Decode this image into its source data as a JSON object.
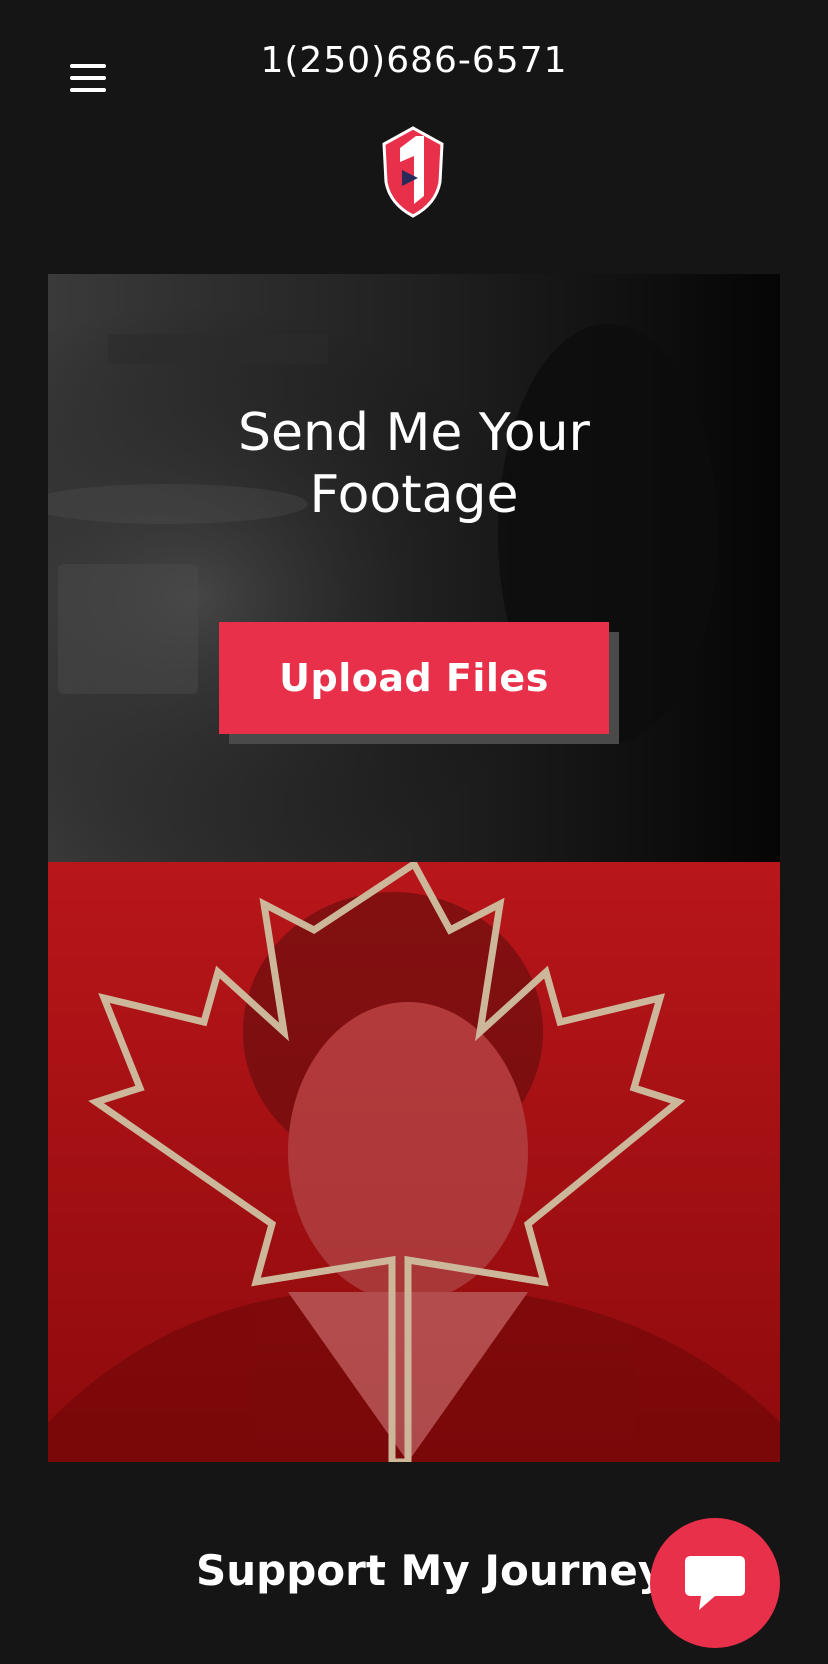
{
  "header": {
    "phone": "1(250)686-6571",
    "menu_icon": "hamburger-menu-icon",
    "logo_icon": "shield-logo-icon"
  },
  "hero": {
    "title_line1": "Send Me Your",
    "title_line2": "Footage",
    "upload_label": "Upload Files"
  },
  "photo": {
    "description_icon": "maple-leaf-icon"
  },
  "footer": {
    "support_label": "Support My Journey",
    "chat_icon": "chat-bubble-icon"
  },
  "colors": {
    "background": "#151515",
    "accent": "#e8304a",
    "photo_tint": "#b01010"
  }
}
